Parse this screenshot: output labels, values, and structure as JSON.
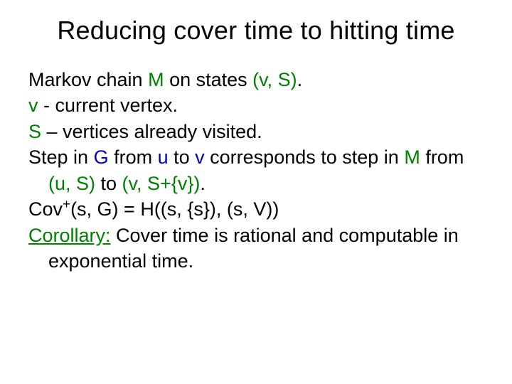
{
  "title": "Reducing cover time to hitting time",
  "lines": {
    "l1a": "Markov chain ",
    "l1b": "M",
    "l1c": " on states ",
    "l1d": "(v, S)",
    "l1e": ".",
    "l2a": "v",
    "l2b": " - current vertex.",
    "l3a": "S",
    "l3b": " – vertices already visited.",
    "l4a": "Step in ",
    "l4b": "G",
    "l4c": " from ",
    "l4d": "u",
    "l4e": " to ",
    "l4f": "v",
    "l4g": " corresponds to step in ",
    "l4h": "M",
    "l4i": " from ",
    "l4j": "(u, S)",
    "l4k": " to ",
    "l4l": "(v, S+{v})",
    "l4m": ".",
    "l5a": "Cov",
    "l5sup": "+",
    "l5b": "(s, G) = H((s, {s}), (s, V))",
    "l6a": "Corollary:",
    "l6b": " Cover time is rational and computable in exponential time."
  }
}
